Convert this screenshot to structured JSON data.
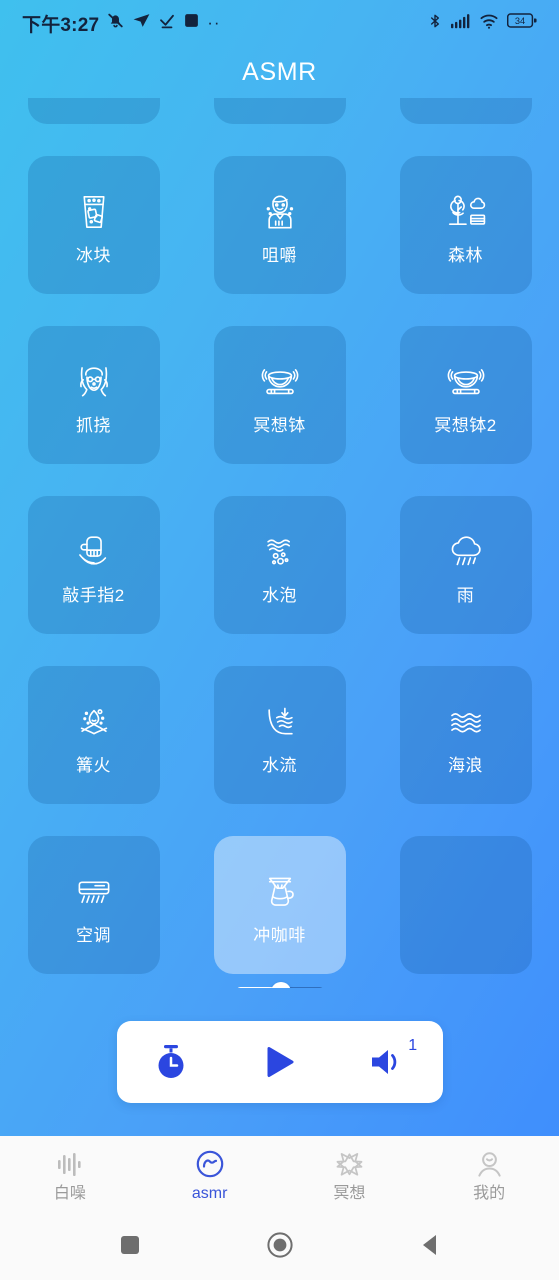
{
  "status_bar": {
    "time": "下午3:27",
    "battery_level": "34",
    "left_icons": [
      "bell-muted-icon",
      "send-arrow-icon",
      "check-download-icon",
      "square-app-icon",
      "more-dots-icon"
    ],
    "right_icons": [
      "bluetooth-icon",
      "cellular-signal-icon",
      "wifi-icon",
      "battery-icon"
    ]
  },
  "header": {
    "title": "ASMR"
  },
  "grid": {
    "cards": [
      {
        "label": "",
        "icon": "partial-top-card",
        "active": false,
        "ghost": true
      },
      {
        "label": "",
        "icon": "partial-top-card",
        "active": false,
        "ghost": true
      },
      {
        "label": "",
        "icon": "partial-top-card",
        "active": false,
        "ghost": true
      },
      {
        "label": "冰块",
        "icon": "ice-glass-icon",
        "active": false
      },
      {
        "label": "咀嚼",
        "icon": "chewing-person-icon",
        "active": false
      },
      {
        "label": "森林",
        "icon": "forest-trees-icon",
        "active": false
      },
      {
        "label": "抓挠",
        "icon": "scratching-head-icon",
        "active": false
      },
      {
        "label": "冥想钵",
        "icon": "singing-bowl-icon",
        "active": false
      },
      {
        "label": "冥想钵2",
        "icon": "singing-bowl-icon",
        "active": false
      },
      {
        "label": "敲手指2",
        "icon": "tapping-fingers-icon",
        "active": false
      },
      {
        "label": "水泡",
        "icon": "bubbles-icon",
        "active": false
      },
      {
        "label": "雨",
        "icon": "rain-cloud-icon",
        "active": false
      },
      {
        "label": "篝火",
        "icon": "campfire-icon",
        "active": false
      },
      {
        "label": "水流",
        "icon": "water-stream-icon",
        "active": false
      },
      {
        "label": "海浪",
        "icon": "ocean-waves-icon",
        "active": false
      },
      {
        "label": "空调",
        "icon": "air-conditioner-icon",
        "active": false
      },
      {
        "label": "冲咖啡",
        "icon": "pourover-coffee-icon",
        "active": true
      },
      {
        "label": "",
        "icon": "empty-slot",
        "active": false,
        "ghost": true
      }
    ],
    "volume_slider": {
      "name": "card-volume-slider",
      "value_percent": 52
    }
  },
  "player": {
    "timer_button": "timer-icon",
    "play_button": "play-icon",
    "volume_button": "volume-icon",
    "volume_badge": "1",
    "accent_color": "#2b46e0"
  },
  "bottom_tabs": {
    "items": [
      {
        "label": "白噪",
        "icon": "waveform-icon",
        "active": false
      },
      {
        "label": "asmr",
        "icon": "asmr-wave-circle-icon",
        "active": true
      },
      {
        "label": "冥想",
        "icon": "star-flower-icon",
        "active": false
      },
      {
        "label": "我的",
        "icon": "person-icon",
        "active": false
      }
    ],
    "active_color": "#3a55d9",
    "inactive_color": "#9a9a9a"
  },
  "android_nav": {
    "recents": "square-recents-icon",
    "home": "circle-home-icon",
    "back": "triangle-back-icon"
  },
  "theme": {
    "gradient_start": "#3fc0ee",
    "gradient_end": "#3d8bfd",
    "card_bg": "rgba(12,78,140,0.22)",
    "card_active_bg": "rgba(255,255,255,0.42)"
  }
}
